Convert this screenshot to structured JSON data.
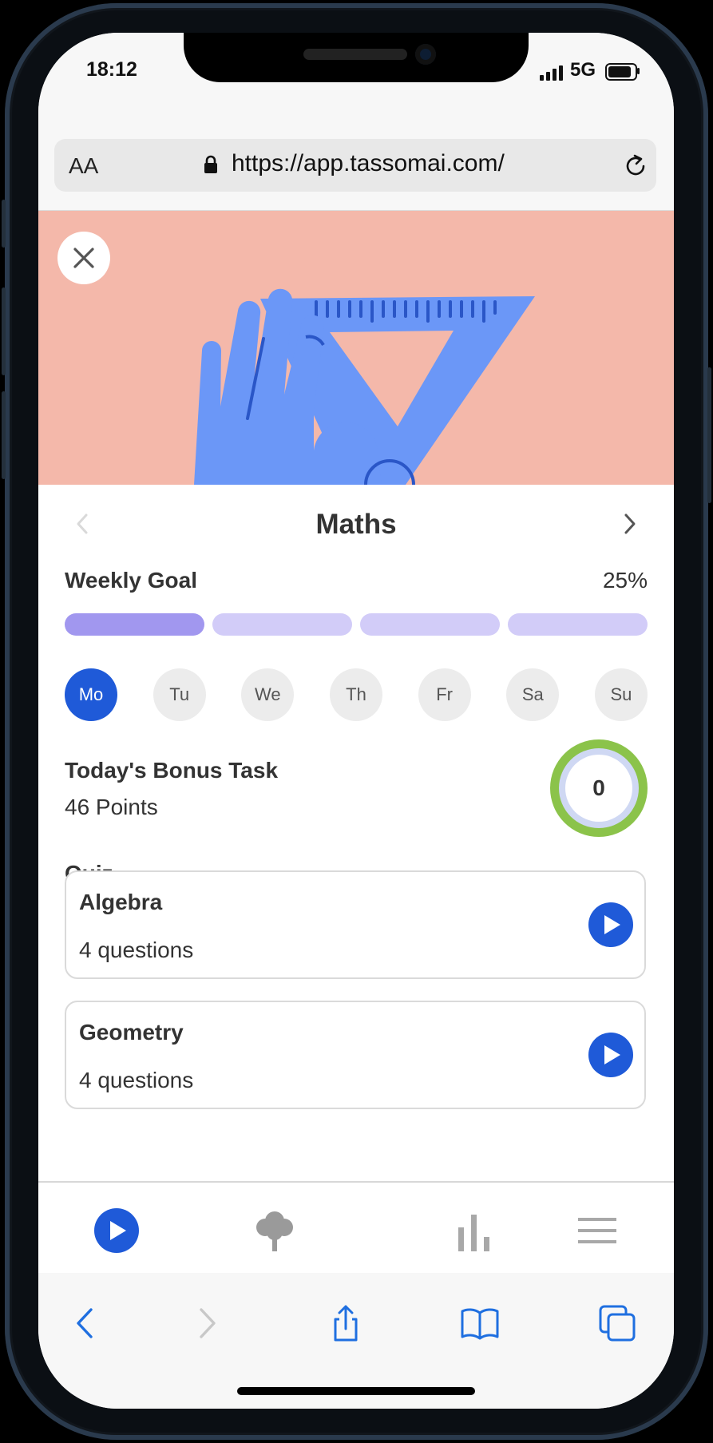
{
  "status_bar": {
    "time": "18:12",
    "network": "5G"
  },
  "browser": {
    "text_size_label": "AA",
    "url": "https://app.tassomai.com/"
  },
  "subject": {
    "title": "Maths"
  },
  "weekly_goal": {
    "label": "Weekly Goal",
    "percent_label": "25%",
    "segments_total": 4,
    "segments_completed": 1,
    "colors": {
      "done": "#a197ef",
      "pending": "#d2ccf8"
    }
  },
  "days": [
    {
      "label": "Mo",
      "active": true
    },
    {
      "label": "Tu",
      "active": false
    },
    {
      "label": "We",
      "active": false
    },
    {
      "label": "Th",
      "active": false
    },
    {
      "label": "Fr",
      "active": false
    },
    {
      "label": "Sa",
      "active": false
    },
    {
      "label": "Su",
      "active": false
    }
  ],
  "bonus_task": {
    "title": "Today's Bonus Task",
    "points": "46 Points",
    "progress_value": "0"
  },
  "quiz": {
    "label": "Quiz",
    "cards": [
      {
        "title": "Algebra",
        "subtitle": "4 questions"
      },
      {
        "title": "Geometry",
        "subtitle": "4 questions"
      }
    ]
  },
  "tab_bar": {
    "icons": [
      "play-icon",
      "tree-icon",
      "bar-chart-icon",
      "menu-icon"
    ]
  },
  "safari_toolbar": {
    "icons": [
      "back-icon",
      "forward-icon",
      "share-icon",
      "bookmarks-icon",
      "tabs-icon"
    ]
  },
  "colors": {
    "accent": "#1f5ad8",
    "hero_background": "#f4b8aa",
    "illustration_blue": "#6b97f7",
    "ring_green": "#8bc34a"
  }
}
